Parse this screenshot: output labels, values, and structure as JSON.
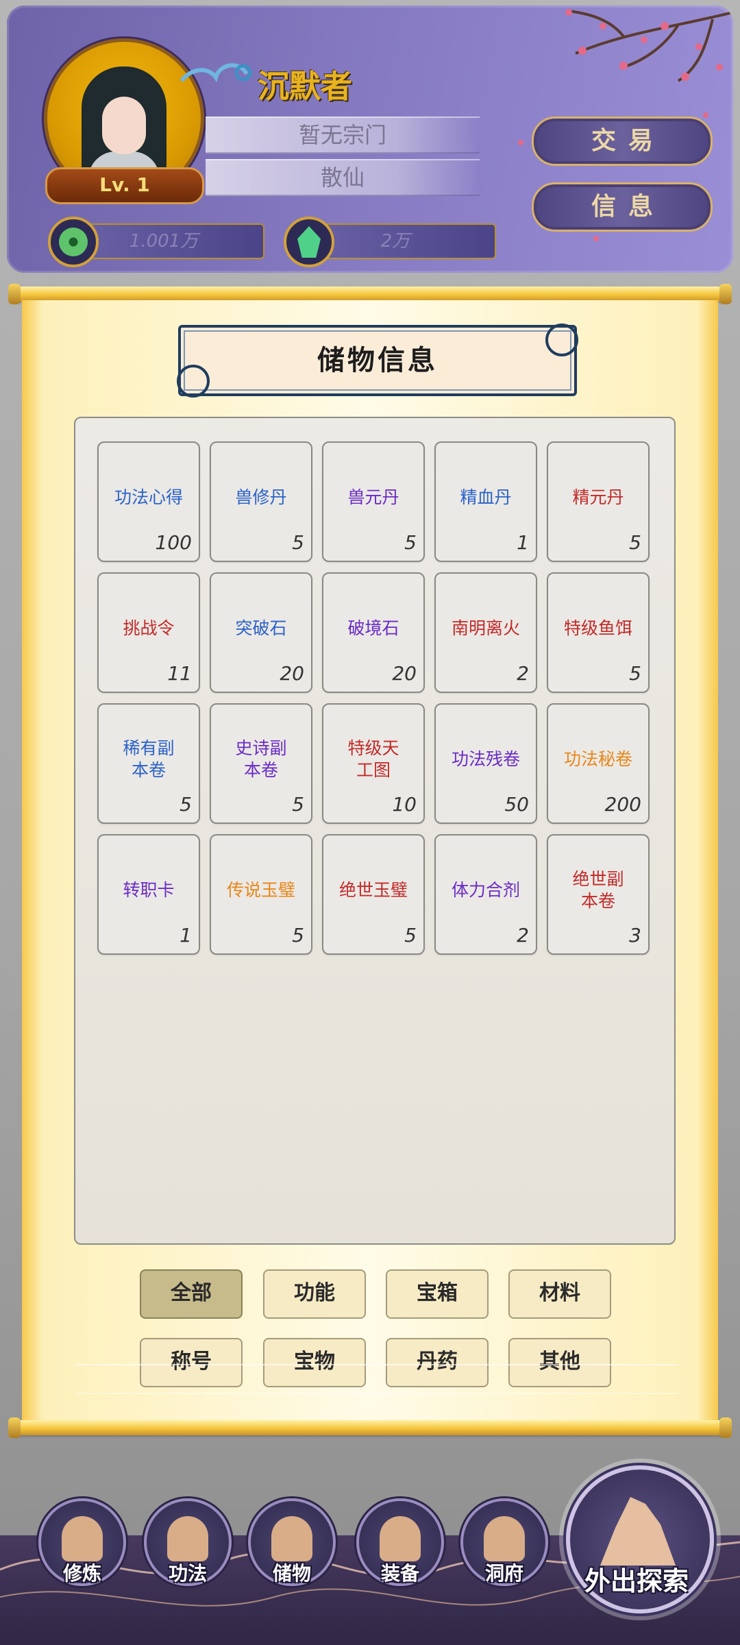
{
  "player": {
    "name": "沉默者",
    "level": "Lv. 1",
    "sect": "暂无宗门",
    "title": "散仙"
  },
  "resources": {
    "coins": "1.001万",
    "gems": "2万"
  },
  "header_buttons": {
    "trade": "交易",
    "info": "信息"
  },
  "panel": {
    "title": "储物信息"
  },
  "items": [
    {
      "name": "功法心得",
      "count": "100",
      "color": "#2a62c9"
    },
    {
      "name": "兽修丹",
      "count": "5",
      "color": "#2a62c9"
    },
    {
      "name": "兽元丹",
      "count": "5",
      "color": "#6a2bc7"
    },
    {
      "name": "精血丹",
      "count": "1",
      "color": "#2a62c9"
    },
    {
      "name": "精元丹",
      "count": "5",
      "color": "#c22a2a"
    },
    {
      "name": "挑战令",
      "count": "11",
      "color": "#c22a2a"
    },
    {
      "name": "突破石",
      "count": "20",
      "color": "#2a62c9"
    },
    {
      "name": "破境石",
      "count": "20",
      "color": "#6a2bc7"
    },
    {
      "name": "南明离火",
      "count": "2",
      "color": "#c22a2a"
    },
    {
      "name": "特级鱼饵",
      "count": "5",
      "color": "#c22a2a"
    },
    {
      "name": "稀有副\n本卷",
      "count": "5",
      "color": "#2a62c9"
    },
    {
      "name": "史诗副\n本卷",
      "count": "5",
      "color": "#6a2bc7"
    },
    {
      "name": "特级天\n工图",
      "count": "10",
      "color": "#c22a2a"
    },
    {
      "name": "功法残卷",
      "count": "50",
      "color": "#6a2bc7"
    },
    {
      "name": "功法秘卷",
      "count": "200",
      "color": "#e8861a"
    },
    {
      "name": "转职卡",
      "count": "1",
      "color": "#6a2bc7"
    },
    {
      "name": "传说玉璧",
      "count": "5",
      "color": "#e8861a"
    },
    {
      "name": "绝世玉璧",
      "count": "5",
      "color": "#c22a2a"
    },
    {
      "name": "体力合剂",
      "count": "2",
      "color": "#6a2bc7"
    },
    {
      "name": "绝世副\n本卷",
      "count": "3",
      "color": "#c22a2a"
    }
  ],
  "filter_tabs": [
    {
      "label": "全部",
      "active": true
    },
    {
      "label": "功能",
      "active": false
    },
    {
      "label": "宝箱",
      "active": false
    },
    {
      "label": "材料",
      "active": false
    },
    {
      "label": "称号",
      "active": false
    },
    {
      "label": "宝物",
      "active": false
    },
    {
      "label": "丹药",
      "active": false
    },
    {
      "label": "其他",
      "active": false
    }
  ],
  "bottom_nav": [
    {
      "label": "修炼",
      "icon": "cultivate-icon"
    },
    {
      "label": "功法",
      "icon": "scroll-icon"
    },
    {
      "label": "储物",
      "icon": "bag-icon"
    },
    {
      "label": "装备",
      "icon": "armor-icon"
    },
    {
      "label": "洞府",
      "icon": "residence-icon"
    }
  ],
  "explore": {
    "label": "外出探索",
    "icon": "mountain-icon"
  }
}
